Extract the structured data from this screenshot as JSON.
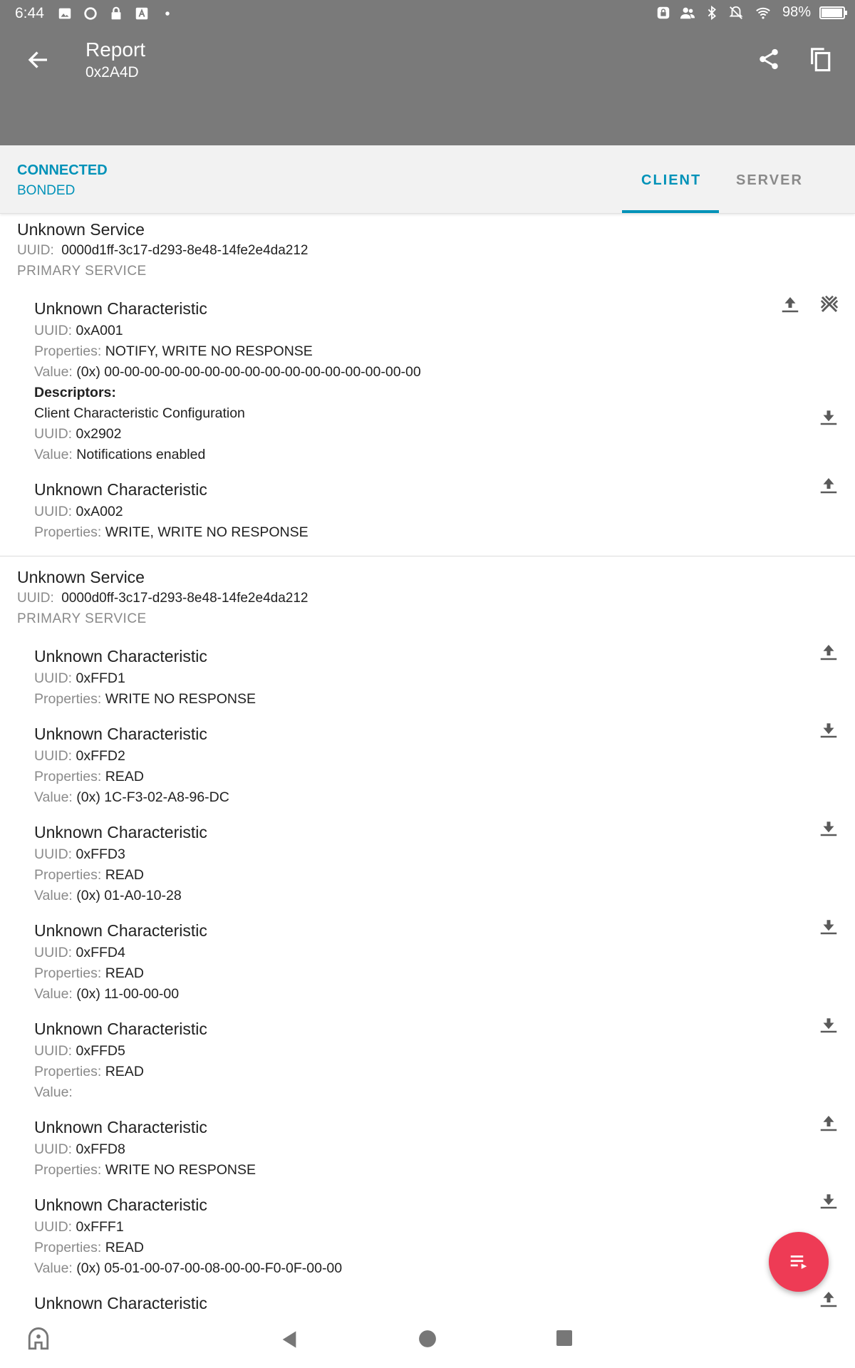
{
  "status_bar": {
    "time": "6:44",
    "battery": "98%",
    "battery_level": 0.98
  },
  "app_bar": {
    "title": "Report",
    "subtitle": "0x2A4D"
  },
  "connection": {
    "state": "CONNECTED",
    "bond": "BONDED"
  },
  "tabs": [
    {
      "label": "CLIENT",
      "selected": true
    },
    {
      "label": "SERVER",
      "selected": false
    }
  ],
  "labels": {
    "uuid": "UUID:",
    "properties": "Properties:",
    "value": "Value:",
    "descriptors": "Descriptors:"
  },
  "services": [
    {
      "name": "Unknown Service",
      "uuid": "0000d1ff-3c17-d293-8e48-14fe2e4da212",
      "type": "PRIMARY SERVICE",
      "characteristics": [
        {
          "name": "Unknown Characteristic",
          "uuid": "0xA001",
          "properties": "NOTIFY, WRITE NO RESPONSE",
          "value": "(0x) 00-00-00-00-00-00-00-00-00-00-00-00-00-00-00-00",
          "descriptor": {
            "name": "Client Characteristic Configuration",
            "uuid": "0x2902",
            "value": "Notifications enabled"
          }
        },
        {
          "name": "Unknown Characteristic",
          "uuid": "0xA002",
          "properties": "WRITE, WRITE NO RESPONSE"
        }
      ]
    },
    {
      "name": "Unknown Service",
      "uuid": "0000d0ff-3c17-d293-8e48-14fe2e4da212",
      "type": "PRIMARY SERVICE",
      "characteristics": [
        {
          "name": "Unknown Characteristic",
          "uuid": "0xFFD1",
          "properties": "WRITE NO RESPONSE"
        },
        {
          "name": "Unknown Characteristic",
          "uuid": "0xFFD2",
          "properties": "READ",
          "value": "(0x) 1C-F3-02-A8-96-DC"
        },
        {
          "name": "Unknown Characteristic",
          "uuid": "0xFFD3",
          "properties": "READ",
          "value": "(0x) 01-A0-10-28"
        },
        {
          "name": "Unknown Characteristic",
          "uuid": "0xFFD4",
          "properties": "READ",
          "value": "(0x) 11-00-00-00"
        },
        {
          "name": "Unknown Characteristic",
          "uuid": "0xFFD5",
          "properties": "READ",
          "value": ""
        },
        {
          "name": "Unknown Characteristic",
          "uuid": "0xFFD8",
          "properties": "WRITE NO RESPONSE"
        },
        {
          "name": "Unknown Characteristic",
          "uuid": "0xFFF1",
          "properties": "READ",
          "value": "(0x) 05-01-00-07-00-08-00-00-F0-0F-00-00"
        },
        {
          "name": "Unknown Characteristic"
        }
      ]
    }
  ],
  "colors": {
    "accent": "#0092b8",
    "app_bar": "#7a7a7a",
    "fab": "#ee3b55"
  }
}
